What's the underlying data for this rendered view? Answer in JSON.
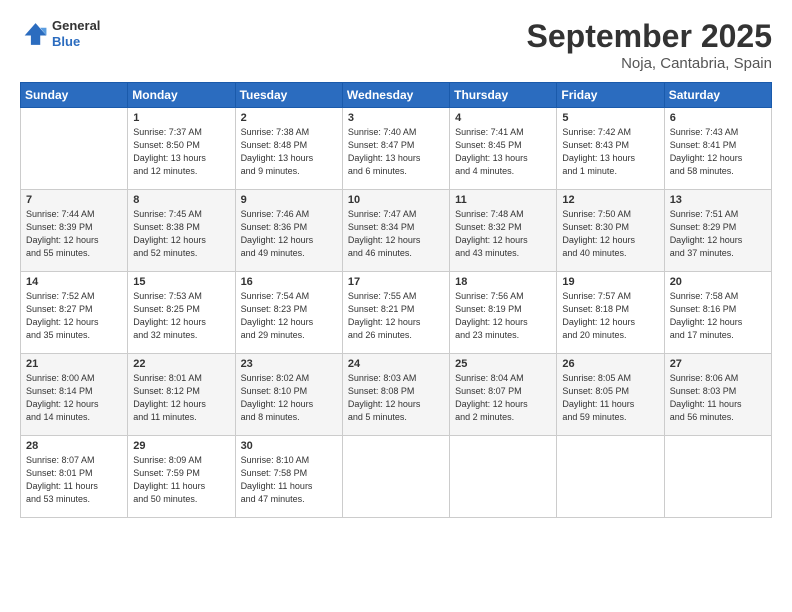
{
  "logo": {
    "line1": "General",
    "line2": "Blue"
  },
  "title": "September 2025",
  "location": "Noja, Cantabria, Spain",
  "days_of_week": [
    "Sunday",
    "Monday",
    "Tuesday",
    "Wednesday",
    "Thursday",
    "Friday",
    "Saturday"
  ],
  "weeks": [
    [
      {
        "day": "",
        "info": ""
      },
      {
        "day": "1",
        "info": "Sunrise: 7:37 AM\nSunset: 8:50 PM\nDaylight: 13 hours\nand 12 minutes."
      },
      {
        "day": "2",
        "info": "Sunrise: 7:38 AM\nSunset: 8:48 PM\nDaylight: 13 hours\nand 9 minutes."
      },
      {
        "day": "3",
        "info": "Sunrise: 7:40 AM\nSunset: 8:47 PM\nDaylight: 13 hours\nand 6 minutes."
      },
      {
        "day": "4",
        "info": "Sunrise: 7:41 AM\nSunset: 8:45 PM\nDaylight: 13 hours\nand 4 minutes."
      },
      {
        "day": "5",
        "info": "Sunrise: 7:42 AM\nSunset: 8:43 PM\nDaylight: 13 hours\nand 1 minute."
      },
      {
        "day": "6",
        "info": "Sunrise: 7:43 AM\nSunset: 8:41 PM\nDaylight: 12 hours\nand 58 minutes."
      }
    ],
    [
      {
        "day": "7",
        "info": "Sunrise: 7:44 AM\nSunset: 8:39 PM\nDaylight: 12 hours\nand 55 minutes."
      },
      {
        "day": "8",
        "info": "Sunrise: 7:45 AM\nSunset: 8:38 PM\nDaylight: 12 hours\nand 52 minutes."
      },
      {
        "day": "9",
        "info": "Sunrise: 7:46 AM\nSunset: 8:36 PM\nDaylight: 12 hours\nand 49 minutes."
      },
      {
        "day": "10",
        "info": "Sunrise: 7:47 AM\nSunset: 8:34 PM\nDaylight: 12 hours\nand 46 minutes."
      },
      {
        "day": "11",
        "info": "Sunrise: 7:48 AM\nSunset: 8:32 PM\nDaylight: 12 hours\nand 43 minutes."
      },
      {
        "day": "12",
        "info": "Sunrise: 7:50 AM\nSunset: 8:30 PM\nDaylight: 12 hours\nand 40 minutes."
      },
      {
        "day": "13",
        "info": "Sunrise: 7:51 AM\nSunset: 8:29 PM\nDaylight: 12 hours\nand 37 minutes."
      }
    ],
    [
      {
        "day": "14",
        "info": "Sunrise: 7:52 AM\nSunset: 8:27 PM\nDaylight: 12 hours\nand 35 minutes."
      },
      {
        "day": "15",
        "info": "Sunrise: 7:53 AM\nSunset: 8:25 PM\nDaylight: 12 hours\nand 32 minutes."
      },
      {
        "day": "16",
        "info": "Sunrise: 7:54 AM\nSunset: 8:23 PM\nDaylight: 12 hours\nand 29 minutes."
      },
      {
        "day": "17",
        "info": "Sunrise: 7:55 AM\nSunset: 8:21 PM\nDaylight: 12 hours\nand 26 minutes."
      },
      {
        "day": "18",
        "info": "Sunrise: 7:56 AM\nSunset: 8:19 PM\nDaylight: 12 hours\nand 23 minutes."
      },
      {
        "day": "19",
        "info": "Sunrise: 7:57 AM\nSunset: 8:18 PM\nDaylight: 12 hours\nand 20 minutes."
      },
      {
        "day": "20",
        "info": "Sunrise: 7:58 AM\nSunset: 8:16 PM\nDaylight: 12 hours\nand 17 minutes."
      }
    ],
    [
      {
        "day": "21",
        "info": "Sunrise: 8:00 AM\nSunset: 8:14 PM\nDaylight: 12 hours\nand 14 minutes."
      },
      {
        "day": "22",
        "info": "Sunrise: 8:01 AM\nSunset: 8:12 PM\nDaylight: 12 hours\nand 11 minutes."
      },
      {
        "day": "23",
        "info": "Sunrise: 8:02 AM\nSunset: 8:10 PM\nDaylight: 12 hours\nand 8 minutes."
      },
      {
        "day": "24",
        "info": "Sunrise: 8:03 AM\nSunset: 8:08 PM\nDaylight: 12 hours\nand 5 minutes."
      },
      {
        "day": "25",
        "info": "Sunrise: 8:04 AM\nSunset: 8:07 PM\nDaylight: 12 hours\nand 2 minutes."
      },
      {
        "day": "26",
        "info": "Sunrise: 8:05 AM\nSunset: 8:05 PM\nDaylight: 11 hours\nand 59 minutes."
      },
      {
        "day": "27",
        "info": "Sunrise: 8:06 AM\nSunset: 8:03 PM\nDaylight: 11 hours\nand 56 minutes."
      }
    ],
    [
      {
        "day": "28",
        "info": "Sunrise: 8:07 AM\nSunset: 8:01 PM\nDaylight: 11 hours\nand 53 minutes."
      },
      {
        "day": "29",
        "info": "Sunrise: 8:09 AM\nSunset: 7:59 PM\nDaylight: 11 hours\nand 50 minutes."
      },
      {
        "day": "30",
        "info": "Sunrise: 8:10 AM\nSunset: 7:58 PM\nDaylight: 11 hours\nand 47 minutes."
      },
      {
        "day": "",
        "info": ""
      },
      {
        "day": "",
        "info": ""
      },
      {
        "day": "",
        "info": ""
      },
      {
        "day": "",
        "info": ""
      }
    ]
  ]
}
